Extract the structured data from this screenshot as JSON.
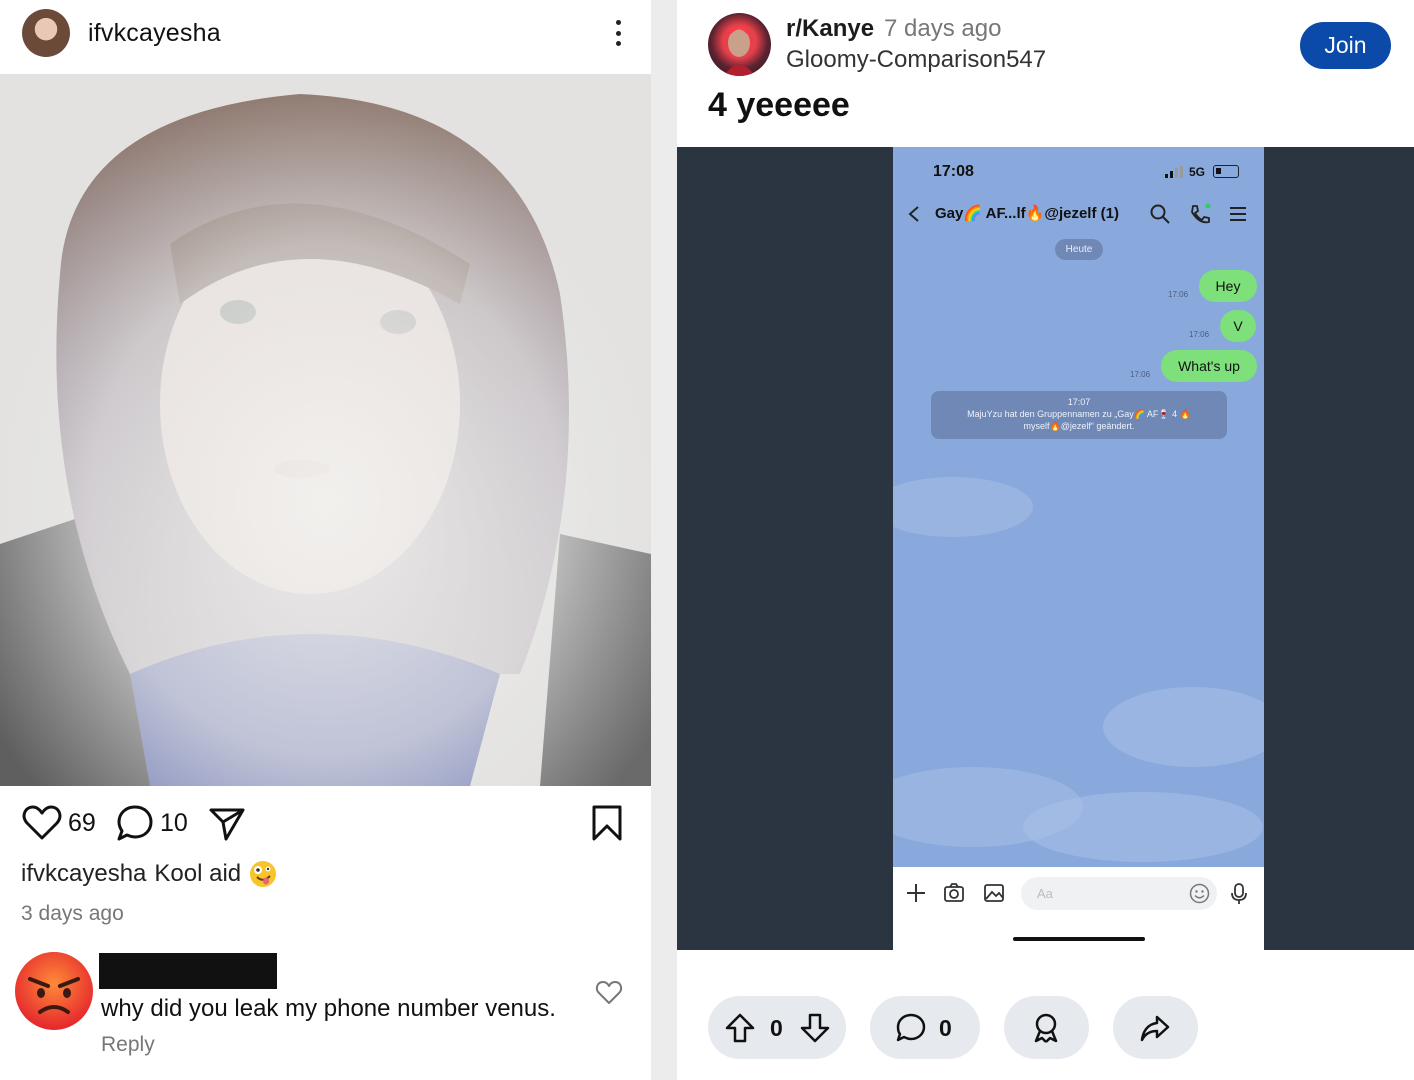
{
  "instagram": {
    "username": "ifvkcayesha",
    "likes": "69",
    "comments_count": "10",
    "caption_user": "ifvkcayesha",
    "caption_text": "Kool aid",
    "posted": "3 days ago",
    "comment": {
      "text": "why did you leak my phone number venus.",
      "reply_label": "Reply"
    }
  },
  "reddit": {
    "subreddit": "r/Kanye",
    "age": "7 days ago",
    "author": "Gloomy-Comparison547",
    "join_label": "Join",
    "title": "4 yeeeee",
    "upvotes": "0",
    "comments": "0",
    "screenshot": {
      "time": "17:08",
      "network": "5G",
      "chat_name": "Gay🌈 AF...lf🔥@jezelf (1)",
      "date_chip": "Heute",
      "messages": [
        {
          "time": "17:06",
          "text": "Hey"
        },
        {
          "time": "17:06",
          "text": "V"
        },
        {
          "time": "17:06",
          "text": "What's up"
        }
      ],
      "system_time": "17:07",
      "system_line1": "MajuYzu hat den Gruppennamen zu „Gay🌈 AF🍷 4 🔥",
      "system_line2": "myself🔥@jezelf“ geändert.",
      "input_placeholder": "Aa"
    }
  },
  "colors": {
    "join_blue": "#0b4aa8",
    "bubble_green": "#7ee07a",
    "chat_bg": "#89a9dc",
    "media_bg": "#2b3441",
    "pill_bg": "#e6eaee"
  }
}
